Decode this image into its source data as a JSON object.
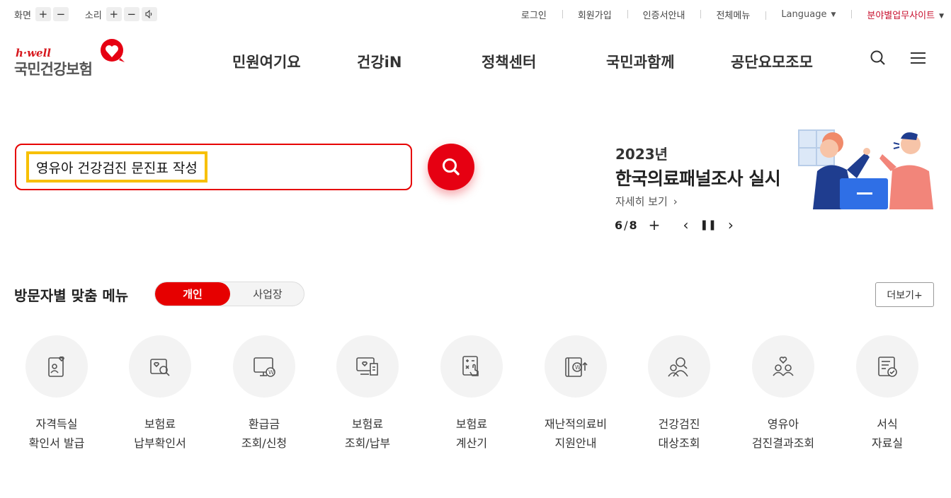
{
  "util": {
    "screen_label": "화면",
    "sound_label": "소리",
    "links": [
      "로그인",
      "회원가입",
      "인증서안내",
      "전체메뉴"
    ],
    "language": "Language",
    "field_site": "분야별업무사이트"
  },
  "logo": {
    "hwell": "h·well",
    "name": "국민건강보험"
  },
  "gnb": [
    "민원여기요",
    "건강iN",
    "정책센터",
    "국민과함께",
    "공단요모조모"
  ],
  "search": {
    "query": "영유아 건강검진 문진표 작성"
  },
  "banner": {
    "year": "2023년",
    "title": "한국의료패널조사 실시",
    "more": "자세히 보기",
    "current": "6",
    "total": "8"
  },
  "visitor": {
    "title": "방문자별 맞춤 메뉴",
    "tab_personal": "개인",
    "tab_business": "사업장",
    "more": "더보기+"
  },
  "menu": [
    {
      "label": "자격득실\n확인서 발급",
      "icon": "id-card-heart-icon"
    },
    {
      "label": "보험료\n납부확인서",
      "icon": "document-search-icon"
    },
    {
      "label": "환급금\n조회/신청",
      "icon": "monitor-won-icon"
    },
    {
      "label": "보험료\n조회/납부",
      "icon": "monitor-receipt-icon"
    },
    {
      "label": "보험료\n계산기",
      "icon": "calculator-hand-icon"
    },
    {
      "label": "재난적의료비\n지원안내",
      "icon": "book-won-icon"
    },
    {
      "label": "건강검진\n대상조회",
      "icon": "people-search-icon"
    },
    {
      "label": "영유아\n검진결과조회",
      "icon": "family-heart-icon"
    },
    {
      "label": "서식\n자료실",
      "icon": "form-check-icon"
    }
  ],
  "colors": {
    "brand_red": "#e60000",
    "highlight": "#f7c000"
  }
}
